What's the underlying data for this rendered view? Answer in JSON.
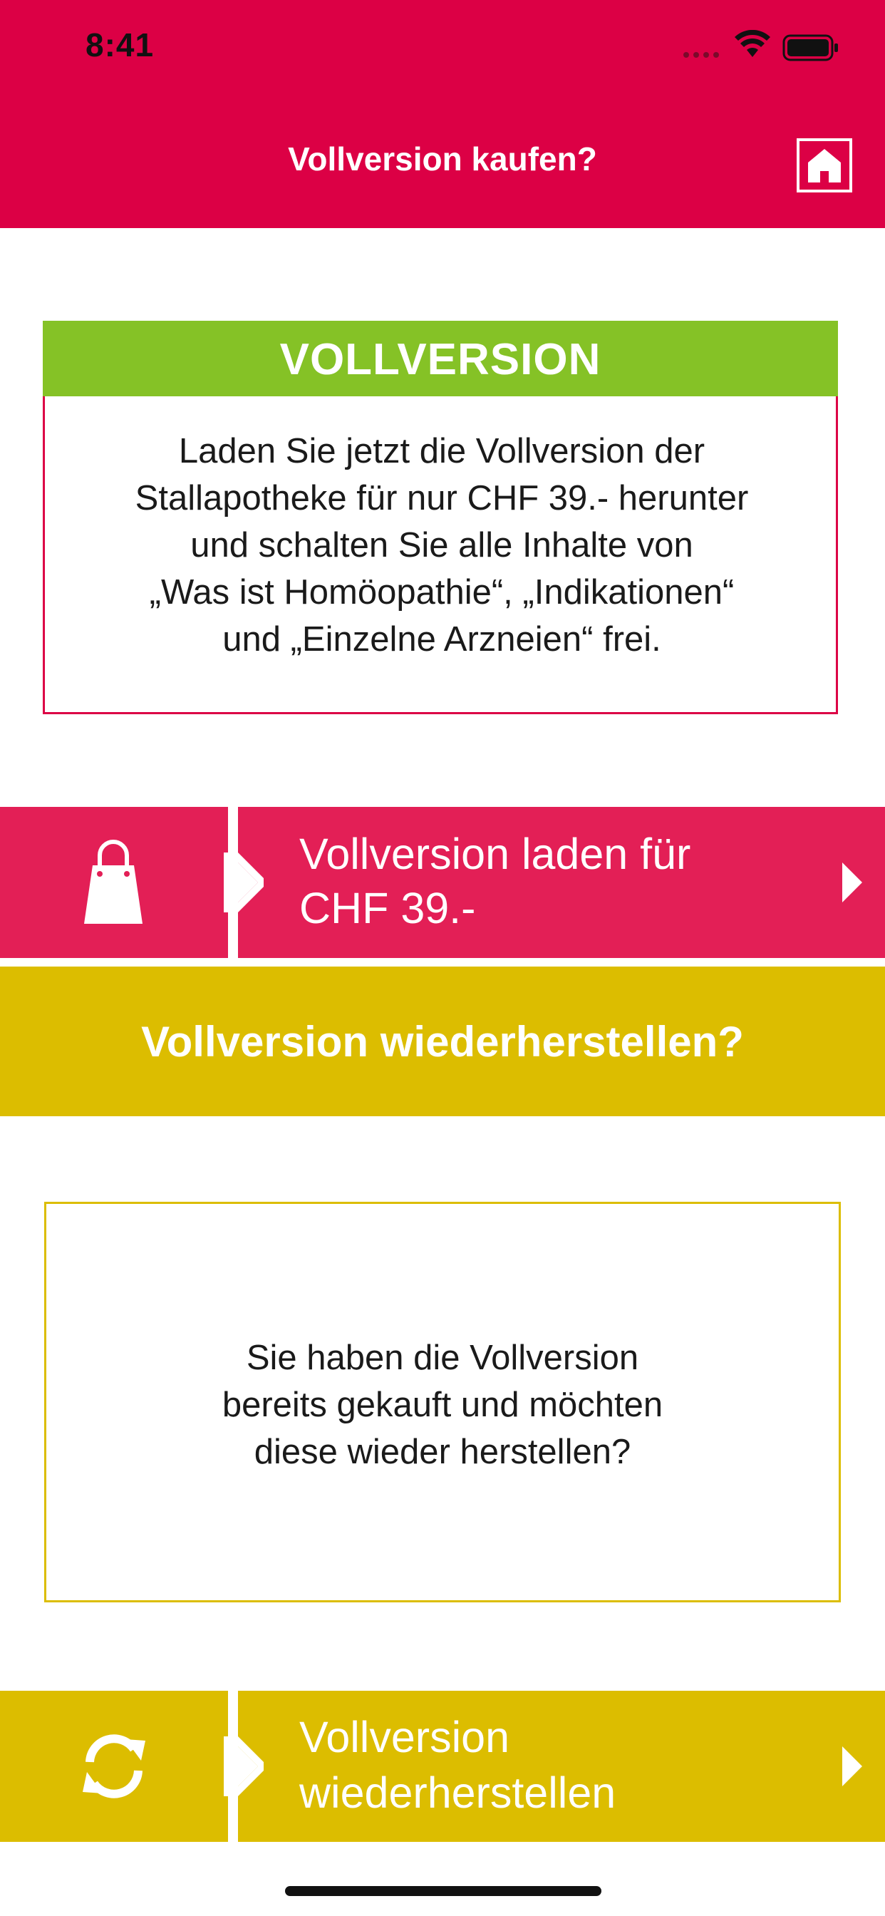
{
  "status_bar": {
    "time": "8:41"
  },
  "header": {
    "title": "Vollversion kaufen?",
    "home_icon": "home-icon",
    "background": "#dc0045"
  },
  "purchase_card": {
    "heading": "VOLLVERSION",
    "lines": [
      "Laden Sie jetzt die Vollversion der",
      "Stallapotheke für nur CHF 39.- herunter",
      "und schalten Sie alle Inhalte von",
      "„Was ist Homöopathie“, „Indikationen“",
      "und „Einzelne Arzneien“ frei."
    ],
    "heading_color": "#85c226",
    "border_color": "#dc0045"
  },
  "buy_button": {
    "label_line1": "Vollversion laden für",
    "label_line2": "CHF 39.-",
    "icon": "shopping-bag-icon",
    "color": "#e31f56"
  },
  "restore_banner": {
    "text": "Vollversion wiederherstellen?",
    "color": "#dcbd00"
  },
  "restore_info": {
    "lines": [
      "Sie haben die Vollversion",
      "bereits gekauft und möchten",
      "diese wieder herstellen?"
    ]
  },
  "restore_button": {
    "label_line1": "Vollversion",
    "label_line2": "wiederherstellen",
    "icon": "sync-icon",
    "color": "#dcbd00"
  }
}
